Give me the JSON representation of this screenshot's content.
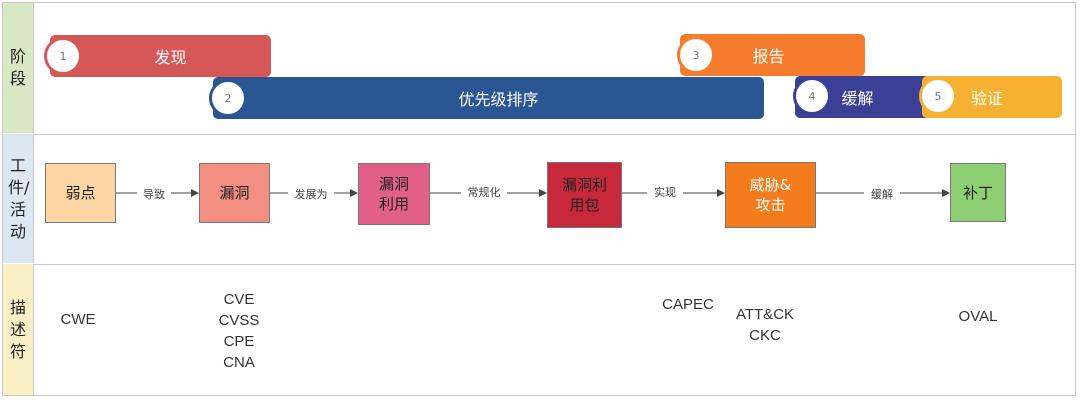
{
  "labels": {
    "stage": "阶段",
    "work": "工件/活动",
    "desc": "描述符"
  },
  "stages": [
    {
      "num": "1",
      "label": "发现",
      "color": "#d65757"
    },
    {
      "num": "2",
      "label": "优先级排序",
      "color": "#2b5694"
    },
    {
      "num": "3",
      "label": "报告",
      "color": "#f57c2d"
    },
    {
      "num": "4",
      "label": "缓解",
      "color": "#3b3f96"
    },
    {
      "num": "5",
      "label": "验证",
      "color": "#f6b132"
    }
  ],
  "artifacts": [
    {
      "label": "弱点",
      "color": "#fcd5a4"
    },
    {
      "label": "漏洞",
      "color": "#f38f82"
    },
    {
      "label": "漏洞利用",
      "color": "#e25f8a"
    },
    {
      "label": "漏洞利用包",
      "color": "#c8283b"
    },
    {
      "label": "威胁&攻击",
      "color": "#f57c1d"
    },
    {
      "label": "补丁",
      "color": "#8fcf73"
    }
  ],
  "connectors": [
    "导致",
    "发展为",
    "常规化",
    "实现",
    "缓解"
  ],
  "descriptors": {
    "weakness": [
      "CWE"
    ],
    "vulnerability": [
      "CVE",
      "CVSS",
      "CPE",
      "CNA"
    ],
    "capec": [
      "CAPEC"
    ],
    "attack": [
      "ATT&CK",
      "CKC"
    ],
    "patch": [
      "OVAL"
    ]
  }
}
